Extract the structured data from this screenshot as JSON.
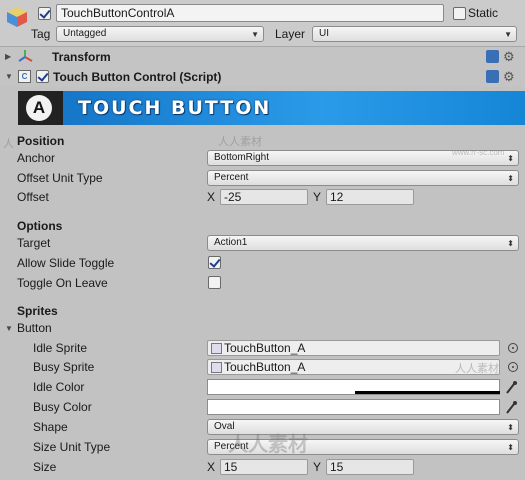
{
  "header": {
    "object_name": "TouchButtonControlA",
    "static_label": "Static",
    "tag_label": "Tag",
    "tag_value": "Untagged",
    "layer_label": "Layer",
    "layer_value": "UI"
  },
  "transform": {
    "title": "Transform"
  },
  "script": {
    "title": "Touch Button Control (Script)"
  },
  "banner": {
    "letter": "A",
    "text": "TOUCH BUTTON",
    "colors": {
      "bg": "#1a86d6",
      "dark": "#111111"
    }
  },
  "position": {
    "header": "Position",
    "anchor_label": "Anchor",
    "anchor_value": "BottomRight",
    "offset_unit_label": "Offset Unit Type",
    "offset_unit_value": "Percent",
    "offset_label": "Offset",
    "x_label": "X",
    "x_value": "-25",
    "y_label": "Y",
    "y_value": "12"
  },
  "options": {
    "header": "Options",
    "target_label": "Target",
    "target_value": "Action1",
    "slide_label": "Allow Slide Toggle",
    "slide_checked": true,
    "leave_label": "Toggle On Leave",
    "leave_checked": false
  },
  "sprites": {
    "header": "Sprites",
    "button_label": "Button",
    "idle_sprite_label": "Idle Sprite",
    "idle_sprite_value": "TouchButton_A",
    "busy_sprite_label": "Busy Sprite",
    "busy_sprite_value": "TouchButton_A",
    "idle_color_label": "Idle Color",
    "busy_color_label": "Busy Color",
    "shape_label": "Shape",
    "shape_value": "Oval",
    "size_unit_label": "Size Unit Type",
    "size_unit_value": "Percent",
    "size_label": "Size",
    "size_x_label": "X",
    "size_x_value": "15",
    "size_y_label": "Y",
    "size_y_value": "15"
  },
  "watermarks": {
    "text1": "人人素材",
    "text2": "www.rr-sc.com",
    "text3": "人人素材",
    "text4": "人",
    "text5": "人人素材"
  }
}
